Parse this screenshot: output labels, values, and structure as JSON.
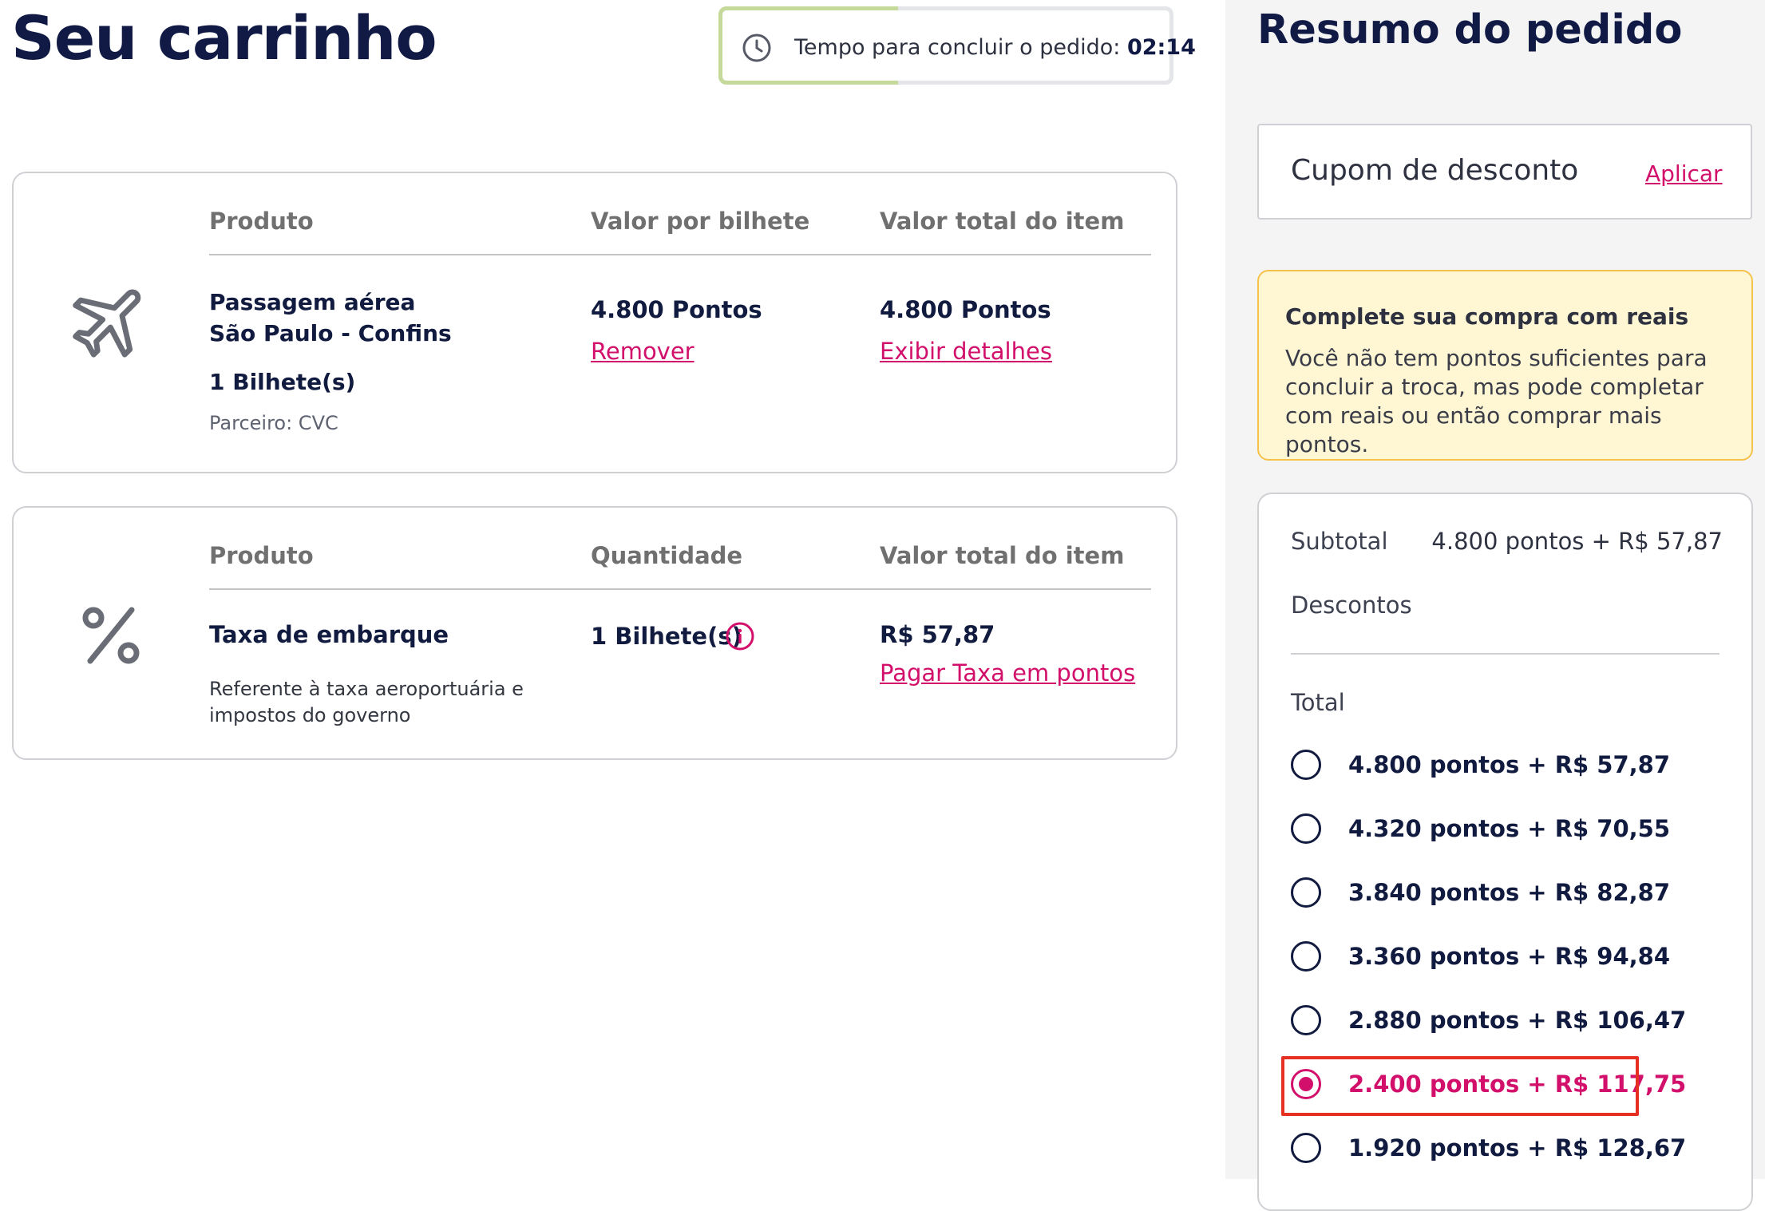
{
  "header": {
    "title": "Seu carrinho",
    "timer_label": "Tempo para concluir o pedido:",
    "timer_value": "02:14",
    "timer_icon": "clock-icon"
  },
  "cart": {
    "flight": {
      "icon": "airplane-icon",
      "col_product": "Produto",
      "col_unit_value": "Valor por bilhete",
      "col_total": "Valor total do item",
      "name_line1": "Passagem aérea",
      "name_line2": "São Paulo - Confins",
      "tickets": "1 Bilhete(s)",
      "partner": "Parceiro: CVC",
      "unit_value": "4.800 Pontos",
      "remove_label": "Remover",
      "total_value": "4.800 Pontos",
      "details_label": "Exibir detalhes"
    },
    "fee": {
      "icon": "percent-icon",
      "col_product": "Produto",
      "col_quantity": "Quantidade",
      "col_total": "Valor total do item",
      "name": "Taxa de embarque",
      "description": "Referente à taxa aeroportuária e impostos do governo",
      "quantity": "1 Bilhete(s)",
      "quantity_info_icon": "info-icon",
      "total_value": "R$ 57,87",
      "pay_points_label": "Pagar Taxa em pontos"
    }
  },
  "summary": {
    "title": "Resumo do pedido",
    "coupon_label": "Cupom de desconto",
    "coupon_apply": "Aplicar",
    "notice_title": "Complete sua compra com reais",
    "notice_body": "Você não tem pontos suficientes para concluir a troca, mas pode completar com reais ou então comprar mais pontos.",
    "subtotal_label": "Subtotal",
    "subtotal_value": "4.800 pontos + R$ 57,87",
    "discounts_label": "Descontos",
    "total_label": "Total",
    "options": [
      {
        "label": "4.800 pontos + R$ 57,87",
        "selected": false
      },
      {
        "label": "4.320 pontos + R$ 70,55",
        "selected": false
      },
      {
        "label": "3.840 pontos + R$ 82,87",
        "selected": false
      },
      {
        "label": "3.360 pontos + R$ 94,84",
        "selected": false
      },
      {
        "label": "2.880 pontos + R$ 106,47",
        "selected": false
      },
      {
        "label": "2.400 pontos + R$ 117,75",
        "selected": true
      },
      {
        "label": "1.920 pontos + R$ 128,67",
        "selected": false
      }
    ]
  },
  "colors": {
    "brand_navy": "#101a45",
    "link_magenta": "#d2106b",
    "notice_bg": "#fff6d4",
    "notice_border": "#f5c24c",
    "highlight_red": "#e53022",
    "timer_progress": "#c4d99a"
  }
}
